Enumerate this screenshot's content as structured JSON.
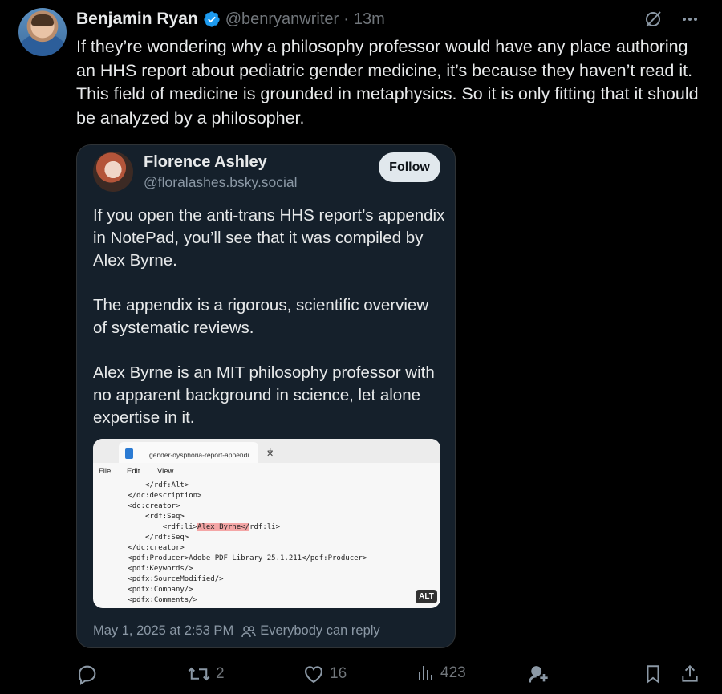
{
  "tweet": {
    "author_name": "Benjamin Ryan",
    "handle": "@benryanwriter",
    "separator": "·",
    "time": "13m",
    "text": "If they’re wondering why a philosophy professor would have any place authoring an HHS report about pediatric gender medicine, it’s because they haven’t read it. This field of medicine is grounded in metaphysics. So it is only fitting that it should be analyzed by a philosopher."
  },
  "quote": {
    "author_name": "Florence Ashley",
    "handle": "@floralashes.bsky.social",
    "follow_label": "Follow",
    "paragraphs": [
      "If you open the anti-trans HHS report’s appendix in NotePad, you’ll see that it was compiled by Alex Byrne.",
      "The appendix is a rigorous, scientific overview of systematic reviews.",
      "Alex Byrne is an MIT philosophy professor with no apparent background in science, let alone expertise in it."
    ],
    "timestamp": "May 1, 2025 at 2:53 PM",
    "reply_setting": "Everybody can reply",
    "screenshot": {
      "tab_title": "gender-dysphoria-report-appendi",
      "tab_close": "✕",
      "tab_new": "+",
      "menu": {
        "file": "File",
        "edit": "Edit",
        "view": "View"
      },
      "lines": [
        "            </rdf:Alt>",
        "        </dc:description>",
        "        <dc:creator>",
        "            <rdf:Seq>",
        "                <rdf:li>",
        "            </rdf:Seq>",
        "        </dc:creator>",
        "        <pdf:Producer>Adobe PDF Library 25.1.211</pdf:Producer>",
        "        <pdf:Keywords/>",
        "        <pdfx:SourceModified/>",
        "        <pdfx:Company/>",
        "        <pdfx:Comments/>"
      ],
      "highlight": "Alex Byrne</",
      "line5_rest": "rdf:li>",
      "alt_badge": "ALT"
    }
  },
  "actions": {
    "retweets": "2",
    "likes": "16",
    "views": "423"
  },
  "colors": {
    "background": "#000000",
    "quote_background": "#15202b",
    "verified_blue": "#1d9bf0",
    "muted_text": "#71767b"
  }
}
